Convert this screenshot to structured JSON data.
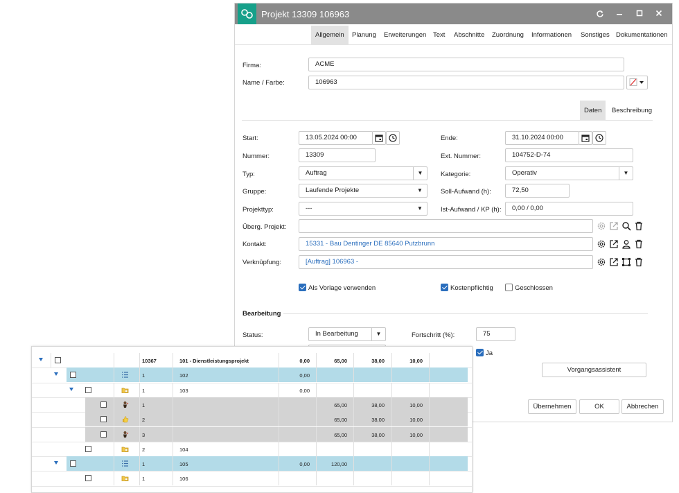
{
  "window": {
    "title": "Projekt 13309 106963"
  },
  "tabs": [
    "Allgemein",
    "Planung",
    "Erweiterungen",
    "Text",
    "Abschnitte",
    "Zuordnung",
    "Informationen",
    "Sonstiges",
    "Dokumentationen"
  ],
  "head": {
    "firma_label": "Firma:",
    "firma_value": "ACME",
    "name_label": "Name / Farbe:",
    "name_value": "106963"
  },
  "subtabs": [
    "Daten",
    "Beschreibung"
  ],
  "form": {
    "start_label": "Start:",
    "start_value": "13.05.2024 00:00",
    "ende_label": "Ende:",
    "ende_value": "31.10.2024 00:00",
    "nummer_label": "Nummer:",
    "nummer_value": "13309",
    "ext_label": "Ext. Nummer:",
    "ext_value": "104752-D-74",
    "typ_label": "Typ:",
    "typ_value": "Auftrag",
    "kategorie_label": "Kategorie:",
    "kategorie_value": "Operativ",
    "gruppe_label": "Gruppe:",
    "gruppe_value": "Laufende Projekte",
    "soll_label": "Soll-Aufwand (h):",
    "soll_value": "72,50",
    "projekttyp_label": "Projekttyp:",
    "projekttyp_value": "---",
    "ist_label": "Ist-Aufwand / KP (h):",
    "ist_value": "0,00 / 0,00",
    "ueberg_label": "Überg. Projekt:",
    "ueberg_value": "",
    "kontakt_label": "Kontakt:",
    "kontakt_value": "15331 - Bau Dentinger DE 85640 Putzbrunn",
    "verkn_label": "Verknüpfung:",
    "verkn_value": "[Auftrag] 106963 -"
  },
  "checks": {
    "vorlage": {
      "label": "Als Vorlage verwenden",
      "checked": true
    },
    "kosten": {
      "label": "Kostenpflichtig",
      "checked": true
    },
    "geschlossen": {
      "label": "Geschlossen",
      "checked": false
    },
    "ja": {
      "label": "Ja",
      "checked": true
    }
  },
  "bearbeitung": {
    "title": "Bearbeitung",
    "status_label": "Status:",
    "status_value": "In Bearbeitung",
    "fortschritt_label": "Fortschritt (%):",
    "fortschritt_value": "75"
  },
  "buttons": {
    "assistent": "Vorgangsassistent",
    "uebernehmen": "Übernehmen",
    "ok": "OK",
    "abbrechen": "Abbrechen"
  },
  "grid": {
    "rows": [
      {
        "level": 0,
        "expand": true,
        "icon": "",
        "style": "header",
        "c1": "10367",
        "c2": "101 - Dienstleistungsprojekt",
        "v1": "0,00",
        "v2": "65,00",
        "v3": "38,00",
        "v4": "10,00"
      },
      {
        "level": 1,
        "expand": true,
        "icon": "list-icon",
        "style": "blue",
        "c1": "1",
        "c2": "102",
        "v1": "0,00",
        "v2": "",
        "v3": "",
        "v4": ""
      },
      {
        "level": 2,
        "expand": true,
        "icon": "folder-icon",
        "style": "white",
        "c1": "1",
        "c2": "103",
        "v1": "0,00",
        "v2": "",
        "v3": "",
        "v4": ""
      },
      {
        "level": 3,
        "expand": false,
        "icon": "person-icon",
        "style": "gray",
        "c1": "1",
        "c2": "",
        "v1": "",
        "v2": "65,00",
        "v3": "38,00",
        "v4": "10,00"
      },
      {
        "level": 3,
        "expand": false,
        "icon": "thumb-icon",
        "style": "gray",
        "c1": "2",
        "c2": "",
        "v1": "",
        "v2": "65,00",
        "v3": "38,00",
        "v4": "10,00"
      },
      {
        "level": 3,
        "expand": false,
        "icon": "person-icon",
        "style": "gray",
        "c1": "3",
        "c2": "",
        "v1": "",
        "v2": "65,00",
        "v3": "38,00",
        "v4": "10,00"
      },
      {
        "level": 2,
        "expand": false,
        "icon": "folder-icon",
        "style": "white",
        "c1": "2",
        "c2": "104",
        "v1": "",
        "v2": "",
        "v3": "",
        "v4": ""
      },
      {
        "level": 1,
        "expand": true,
        "icon": "list-icon",
        "style": "blue",
        "c1": "1",
        "c2": "105",
        "v1": "0,00",
        "v2": "120,00",
        "v3": "",
        "v4": ""
      },
      {
        "level": 2,
        "expand": false,
        "icon": "folder-icon",
        "style": "white",
        "c1": "1",
        "c2": "106",
        "v1": "",
        "v2": "",
        "v3": "",
        "v4": ""
      }
    ]
  }
}
